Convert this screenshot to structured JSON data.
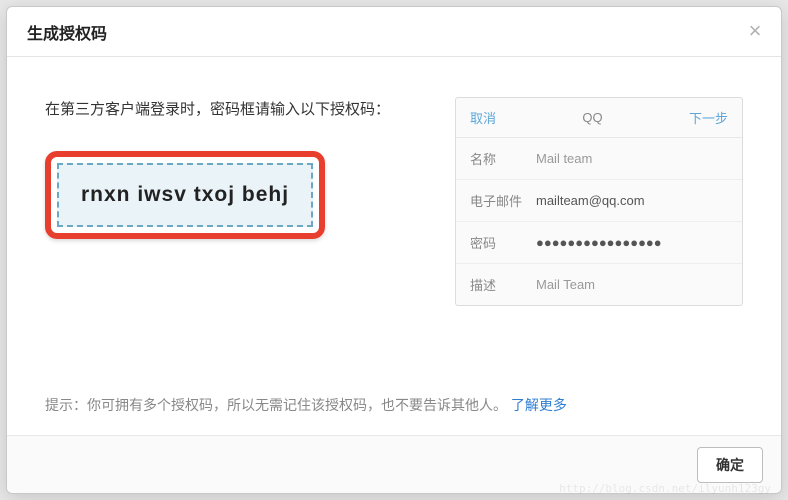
{
  "dialog": {
    "title": "生成授权码",
    "close_label": "×"
  },
  "instruction": "在第三方客户端登录时，密码框请输入以下授权码：",
  "auth_code": "rnxn iwsv txoj behj",
  "phone_panel": {
    "cancel": "取消",
    "center": "QQ",
    "next": "下一步",
    "rows": [
      {
        "label": "名称",
        "value": "Mail team",
        "dark": false
      },
      {
        "label": "电子邮件",
        "value": "mailteam@qq.com",
        "dark": true
      },
      {
        "label": "密码",
        "value": "●●●●●●●●●●●●●●●●",
        "dark": true
      },
      {
        "label": "描述",
        "value": "Mail Team",
        "dark": false
      }
    ]
  },
  "tip": {
    "prefix": "提示：你可拥有多个授权码，所以无需记住该授权码，也不要告诉其他人。",
    "link": "了解更多"
  },
  "footer": {
    "confirm": "确定"
  },
  "watermark": "http://blog.csdn.net/ilyunh123gy"
}
